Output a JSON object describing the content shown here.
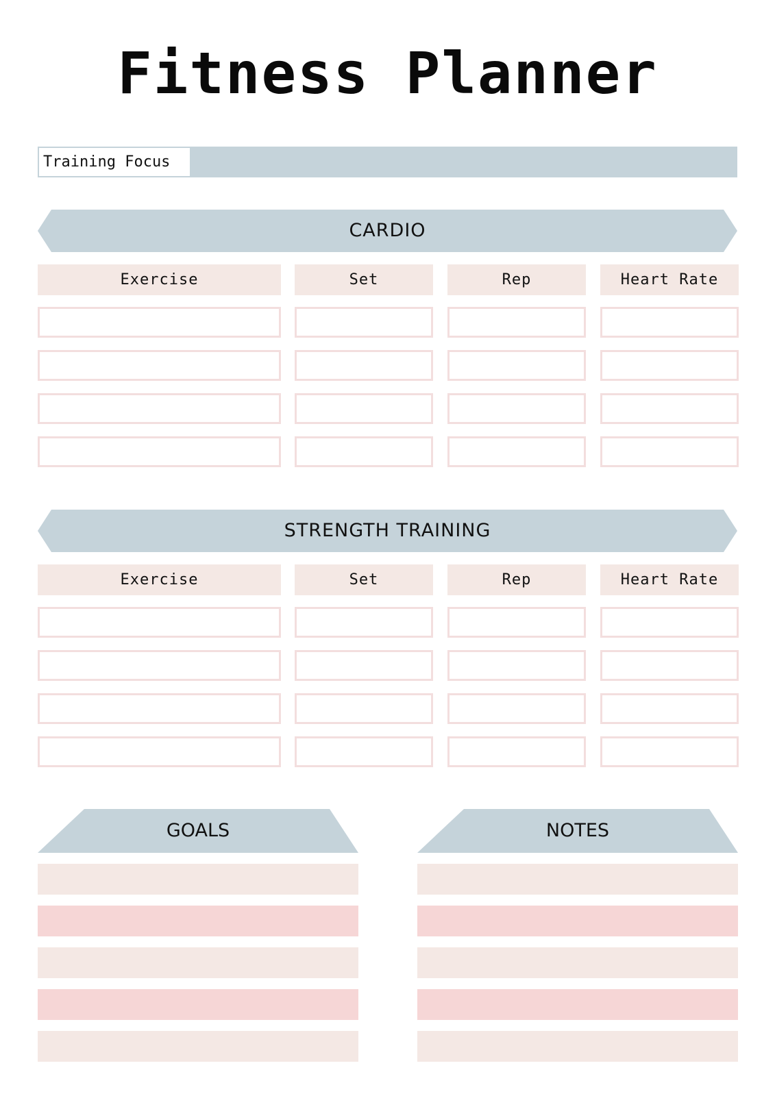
{
  "title": "Fitness Planner",
  "training_focus": {
    "label": "Training Focus",
    "value": ""
  },
  "sections": [
    {
      "name": "CARDIO",
      "columns": [
        "Exercise",
        "Set",
        "Rep",
        "Heart Rate"
      ],
      "rows": [
        [
          "",
          "",
          "",
          ""
        ],
        [
          "",
          "",
          "",
          ""
        ],
        [
          "",
          "",
          "",
          ""
        ],
        [
          "",
          "",
          "",
          ""
        ]
      ]
    },
    {
      "name": "STRENGTH TRAINING",
      "columns": [
        "Exercise",
        "Set",
        "Rep",
        "Heart Rate"
      ],
      "rows": [
        [
          "",
          "",
          "",
          ""
        ],
        [
          "",
          "",
          "",
          ""
        ],
        [
          "",
          "",
          "",
          ""
        ],
        [
          "",
          "",
          "",
          ""
        ]
      ]
    }
  ],
  "goals": {
    "label": "GOALS",
    "lines": [
      "",
      "",
      "",
      "",
      ""
    ]
  },
  "notes": {
    "label": "NOTES",
    "lines": [
      "",
      "",
      "",
      "",
      ""
    ]
  },
  "colors": {
    "banner": "#c5d3da",
    "header_cell": "#f4e8e4",
    "cell_border": "#f3dede",
    "line_light": "#f4e8e4",
    "line_pink": "#f6d6d6"
  }
}
